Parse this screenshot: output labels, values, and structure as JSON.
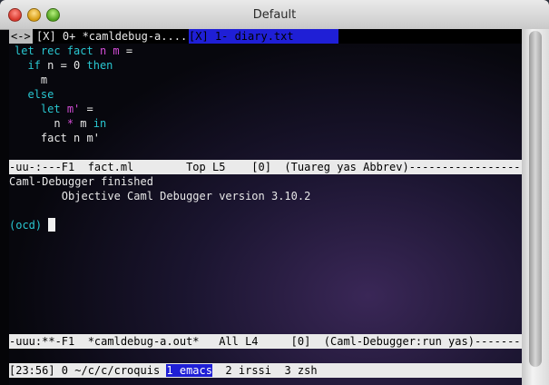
{
  "window": {
    "title": "Default"
  },
  "tabs": {
    "tab1": "<->",
    "tab2": "[X] 0+ *camldebug-a....",
    "tab3": "[X] 1- diary.txt"
  },
  "code": {
    "l1": {
      "kw1": "let rec fact",
      "args": "n m",
      "eq": " ="
    },
    "l2": {
      "kw": "if",
      "cond": "n = 0",
      "then": "then"
    },
    "l3": {
      "text": "m"
    },
    "l4": {
      "kw": "else"
    },
    "l5": {
      "kw": "let",
      "var": "m'",
      "eq": " ="
    },
    "l6": {
      "n": "n",
      "op": "*",
      "m": "m",
      "in": "in"
    },
    "l7": {
      "text": "fact n m'"
    }
  },
  "modeline1": "-uu-:---F1  fact.ml        Top L5    [0]  (Tuareg yas Abbrev)------------------",
  "debugger": {
    "finished": "Caml-Debugger finished",
    "version": "        Objective Caml Debugger version 3.10.2",
    "prompt": "(ocd)"
  },
  "modeline2": "-uuu:**-F1  *camldebug-a.out*   All L4     [0]  (Caml-Debugger:run yas)----------",
  "screen_status": {
    "time": "[23:56] 0 ~/c/c/croquis ",
    "active": "1 emacs",
    "rest": "  2 irssi  3 zsh"
  }
}
